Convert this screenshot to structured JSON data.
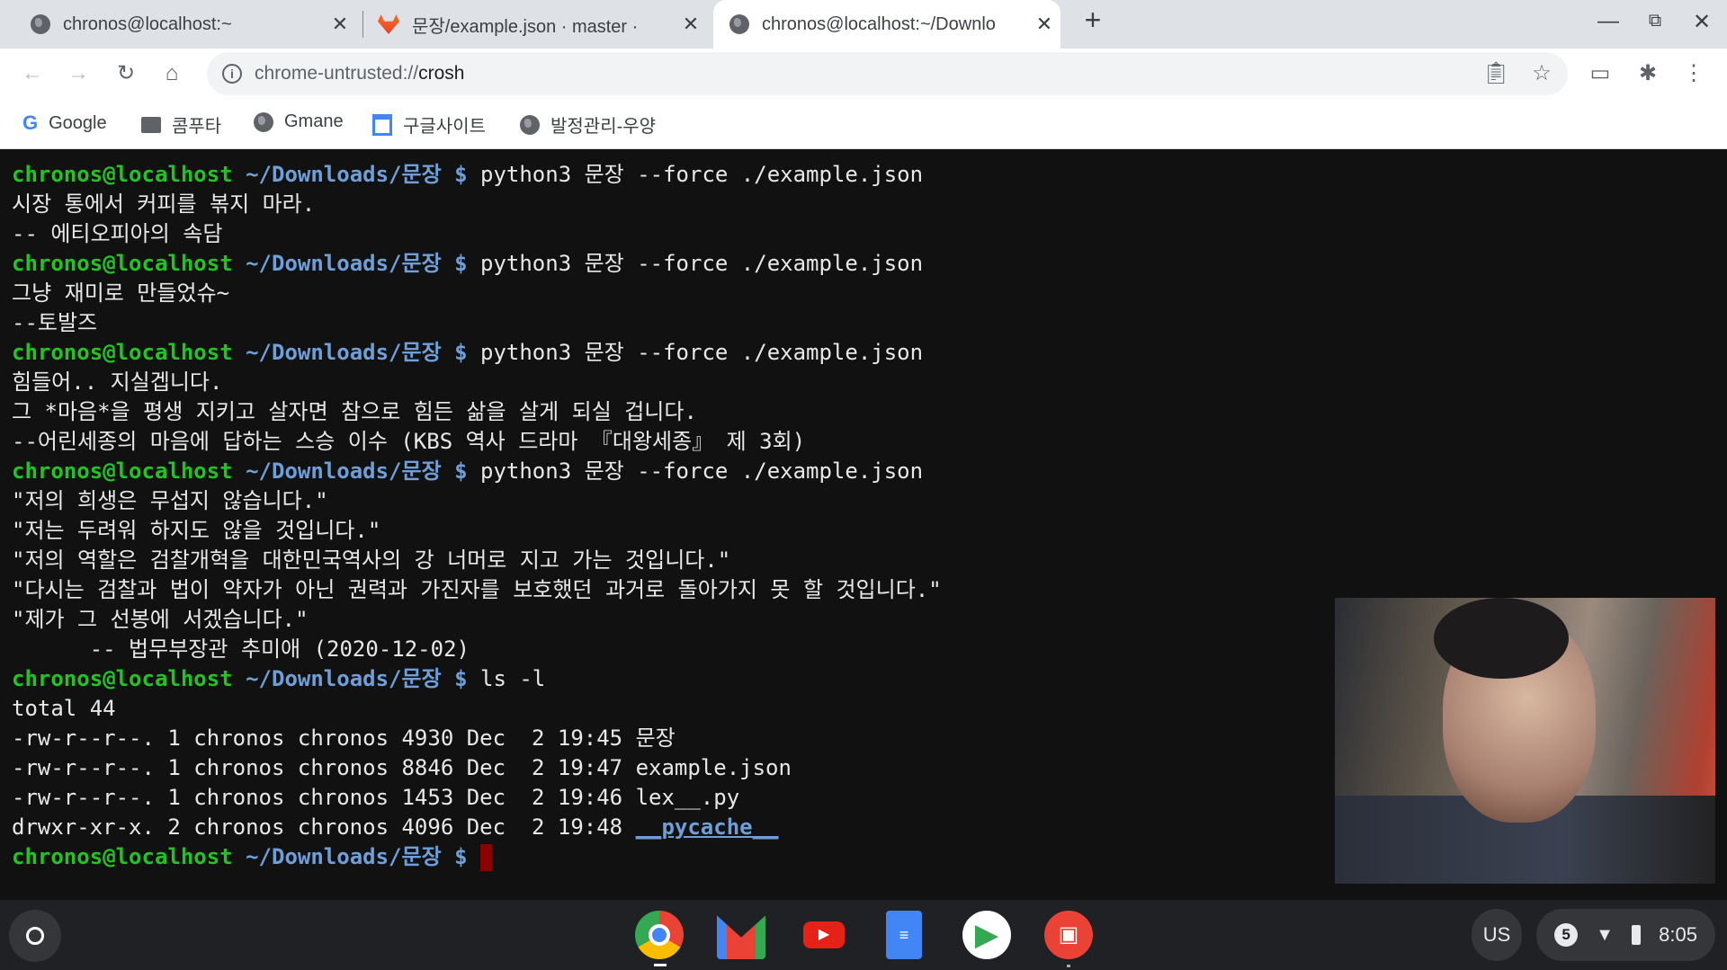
{
  "browser": {
    "tabs": [
      {
        "title": "chronos@localhost:~",
        "icon": "globe-icon",
        "active": false
      },
      {
        "title": "문장/example.json · master · ",
        "icon": "gitlab-icon",
        "active": false
      },
      {
        "title": "chronos@localhost:~/Downlo",
        "icon": "globe-icon",
        "active": true
      }
    ],
    "new_tab": "+",
    "url_prefix": "chrome-untrusted://",
    "url_host": "crosh",
    "bookmarks": [
      {
        "label": "Google",
        "icon": "google-icon"
      },
      {
        "label": "콤푸타",
        "icon": "folder-icon"
      },
      {
        "label": "Gmane",
        "icon": "globe-icon"
      },
      {
        "label": "구글사이트",
        "icon": "sites-icon"
      },
      {
        "label": "발정관리-우양",
        "icon": "globe-icon"
      }
    ]
  },
  "terminal": {
    "colors": {
      "user": "#22c322",
      "path": "#6f9fd8",
      "text": "#e8e8e8",
      "cursor": "#8b0000"
    },
    "lines": [
      {
        "user": "chronos@localhost",
        "path": "~/Downloads/문장 $",
        "cmd": " python3 문장 --force ./example.json"
      },
      {
        "text": "시장 통에서 커피를 볶지 마라."
      },
      {
        "text": "-- 에티오피아의 속담"
      },
      {
        "user": "chronos@localhost",
        "path": "~/Downloads/문장 $",
        "cmd": " python3 문장 --force ./example.json"
      },
      {
        "text": "그냥 재미로 만들었슈~"
      },
      {
        "text": "--토발즈"
      },
      {
        "user": "chronos@localhost",
        "path": "~/Downloads/문장 $",
        "cmd": " python3 문장 --force ./example.json"
      },
      {
        "text": "힘들어.. 지실겝니다."
      },
      {
        "text": "그 *마음*을 평생 지키고 살자면 참으로 힘든 삶을 살게 되실 겁니다."
      },
      {
        "text": "--어린세종의 마음에 답하는 스승 이수 (KBS 역사 드라마 『대왕세종』 제 3회)"
      },
      {
        "user": "chronos@localhost",
        "path": "~/Downloads/문장 $",
        "cmd": " python3 문장 --force ./example.json"
      },
      {
        "text": "\"저의 희생은 무섭지 않습니다.\""
      },
      {
        "text": "\"저는 두려워 하지도 않을 것입니다.\""
      },
      {
        "text": "\"저의 역할은 검찰개혁을 대한민국역사의 강 너머로 지고 가는 것입니다.\""
      },
      {
        "text": "\"다시는 검찰과 법이 약자가 아닌 권력과 가진자를 보호했던 과거로 돌아가지 못 할 것입니다.\""
      },
      {
        "text": "\"제가 그 선봉에 서겠습니다.\""
      },
      {
        "text": "      -- 법무부장관 추미애 (2020-12-02)"
      },
      {
        "user": "chronos@localhost",
        "path": "~/Downloads/문장 $",
        "cmd": " ls -l"
      },
      {
        "text": "total 44"
      },
      {
        "text": "-rw-r--r--. 1 chronos chronos 4930 Dec  2 19:45 문장"
      },
      {
        "text": "-rw-r--r--. 1 chronos chronos 8846 Dec  2 19:47 example.json"
      },
      {
        "text": "-rw-r--r--. 1 chronos chronos 1453 Dec  2 19:46 lex__.py"
      },
      {
        "text": "drwxr-xr-x. 2 chronos chronos 4096 Dec  2 19:48 ",
        "dir": "__pycache__"
      },
      {
        "user": "chronos@localhost",
        "path": "~/Downloads/문장 $",
        "cmd": " ",
        "cursor": true
      }
    ]
  },
  "shelf": {
    "apps": [
      {
        "name": "chrome",
        "icon": "chrome-icon"
      },
      {
        "name": "gmail",
        "icon": "gmail-icon"
      },
      {
        "name": "youtube",
        "icon": "youtube-icon"
      },
      {
        "name": "docs",
        "icon": "docs-icon"
      },
      {
        "name": "play-store",
        "icon": "play-store-icon"
      },
      {
        "name": "screencast",
        "icon": "screencast-icon"
      }
    ],
    "ime": "US",
    "notification_count": "5",
    "time": "8:05"
  }
}
